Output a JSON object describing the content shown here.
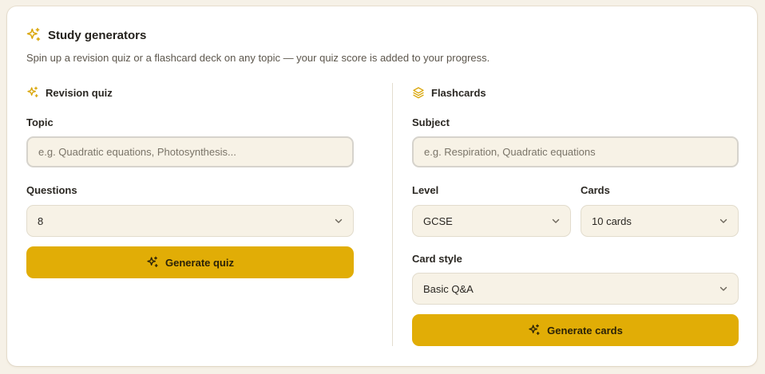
{
  "header": {
    "icon": "sparkles-icon",
    "title": "Study generators",
    "subtitle": "Spin up a revision quiz or a flashcard deck on any topic — your quiz score is added to your progress."
  },
  "quiz": {
    "icon": "sparkles-icon",
    "title": "Revision quiz",
    "topic_label": "Topic",
    "topic_placeholder": "e.g. Quadratic equations, Photosynthesis...",
    "topic_value": "",
    "questions_label": "Questions",
    "questions_value": "8",
    "generate_label": "Generate quiz"
  },
  "flashcards": {
    "icon": "layers-icon",
    "title": "Flashcards",
    "subject_label": "Subject",
    "subject_placeholder": "e.g. Respiration, Quadratic equations",
    "subject_value": "",
    "level_label": "Level",
    "level_value": "GCSE",
    "cards_label": "Cards",
    "cards_value": "10 cards",
    "style_label": "Card style",
    "style_value": "Basic Q&A",
    "generate_label": "Generate cards"
  },
  "colors": {
    "accent": "#e1ad06",
    "icon_gold": "#d9a507",
    "field_bg": "#f7f2e6",
    "page_bg": "#f6f1e7"
  }
}
